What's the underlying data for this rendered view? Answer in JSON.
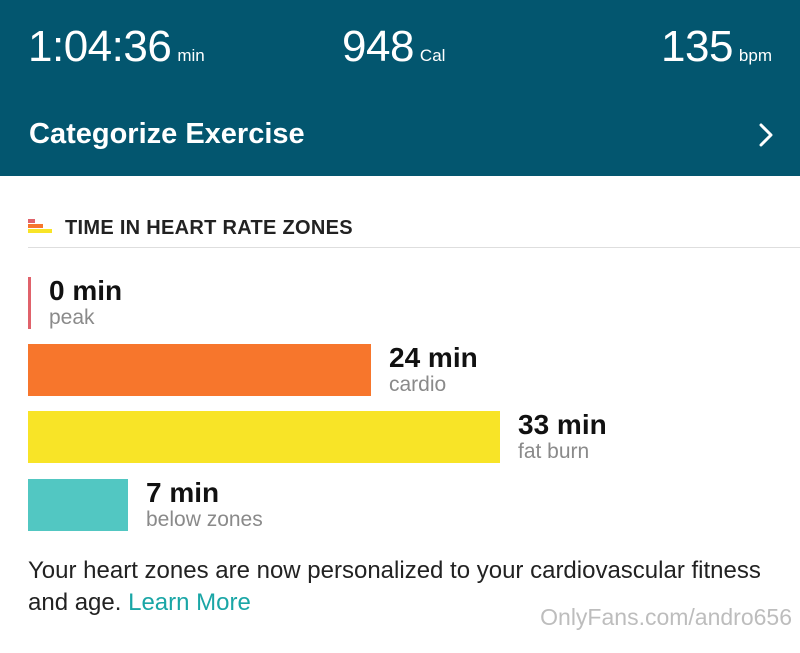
{
  "stats": {
    "duration": {
      "value": "1:04:36",
      "unit": "min"
    },
    "calories": {
      "value": "948",
      "unit": "Cal"
    },
    "heart_rate": {
      "value": "135",
      "unit": "bpm"
    }
  },
  "categorize": {
    "label": "Categorize Exercise",
    "icon": "chevron-right-icon"
  },
  "zones_section": {
    "title": "TIME IN HEART RATE ZONES",
    "icon": "heart-rate-zones-icon",
    "zones": [
      {
        "minutes_label": "0 min",
        "name": "peak",
        "minutes": 0,
        "color": "#e0626b"
      },
      {
        "minutes_label": "24 min",
        "name": "cardio",
        "minutes": 24,
        "color": "#f7762c"
      },
      {
        "minutes_label": "33 min",
        "name": "fat burn",
        "minutes": 33,
        "color": "#f8e427"
      },
      {
        "minutes_label": "7 min",
        "name": "below zones",
        "minutes": 7,
        "color": "#52c7c2"
      }
    ]
  },
  "footnote": {
    "text": "Your heart zones are now personalized to your cardiovascular fitness and age.",
    "link": "Learn More"
  },
  "watermark": "OnlyFans.com/andro656",
  "colors": {
    "header_bg": "#03566f",
    "link": "#1aa6a6"
  }
}
